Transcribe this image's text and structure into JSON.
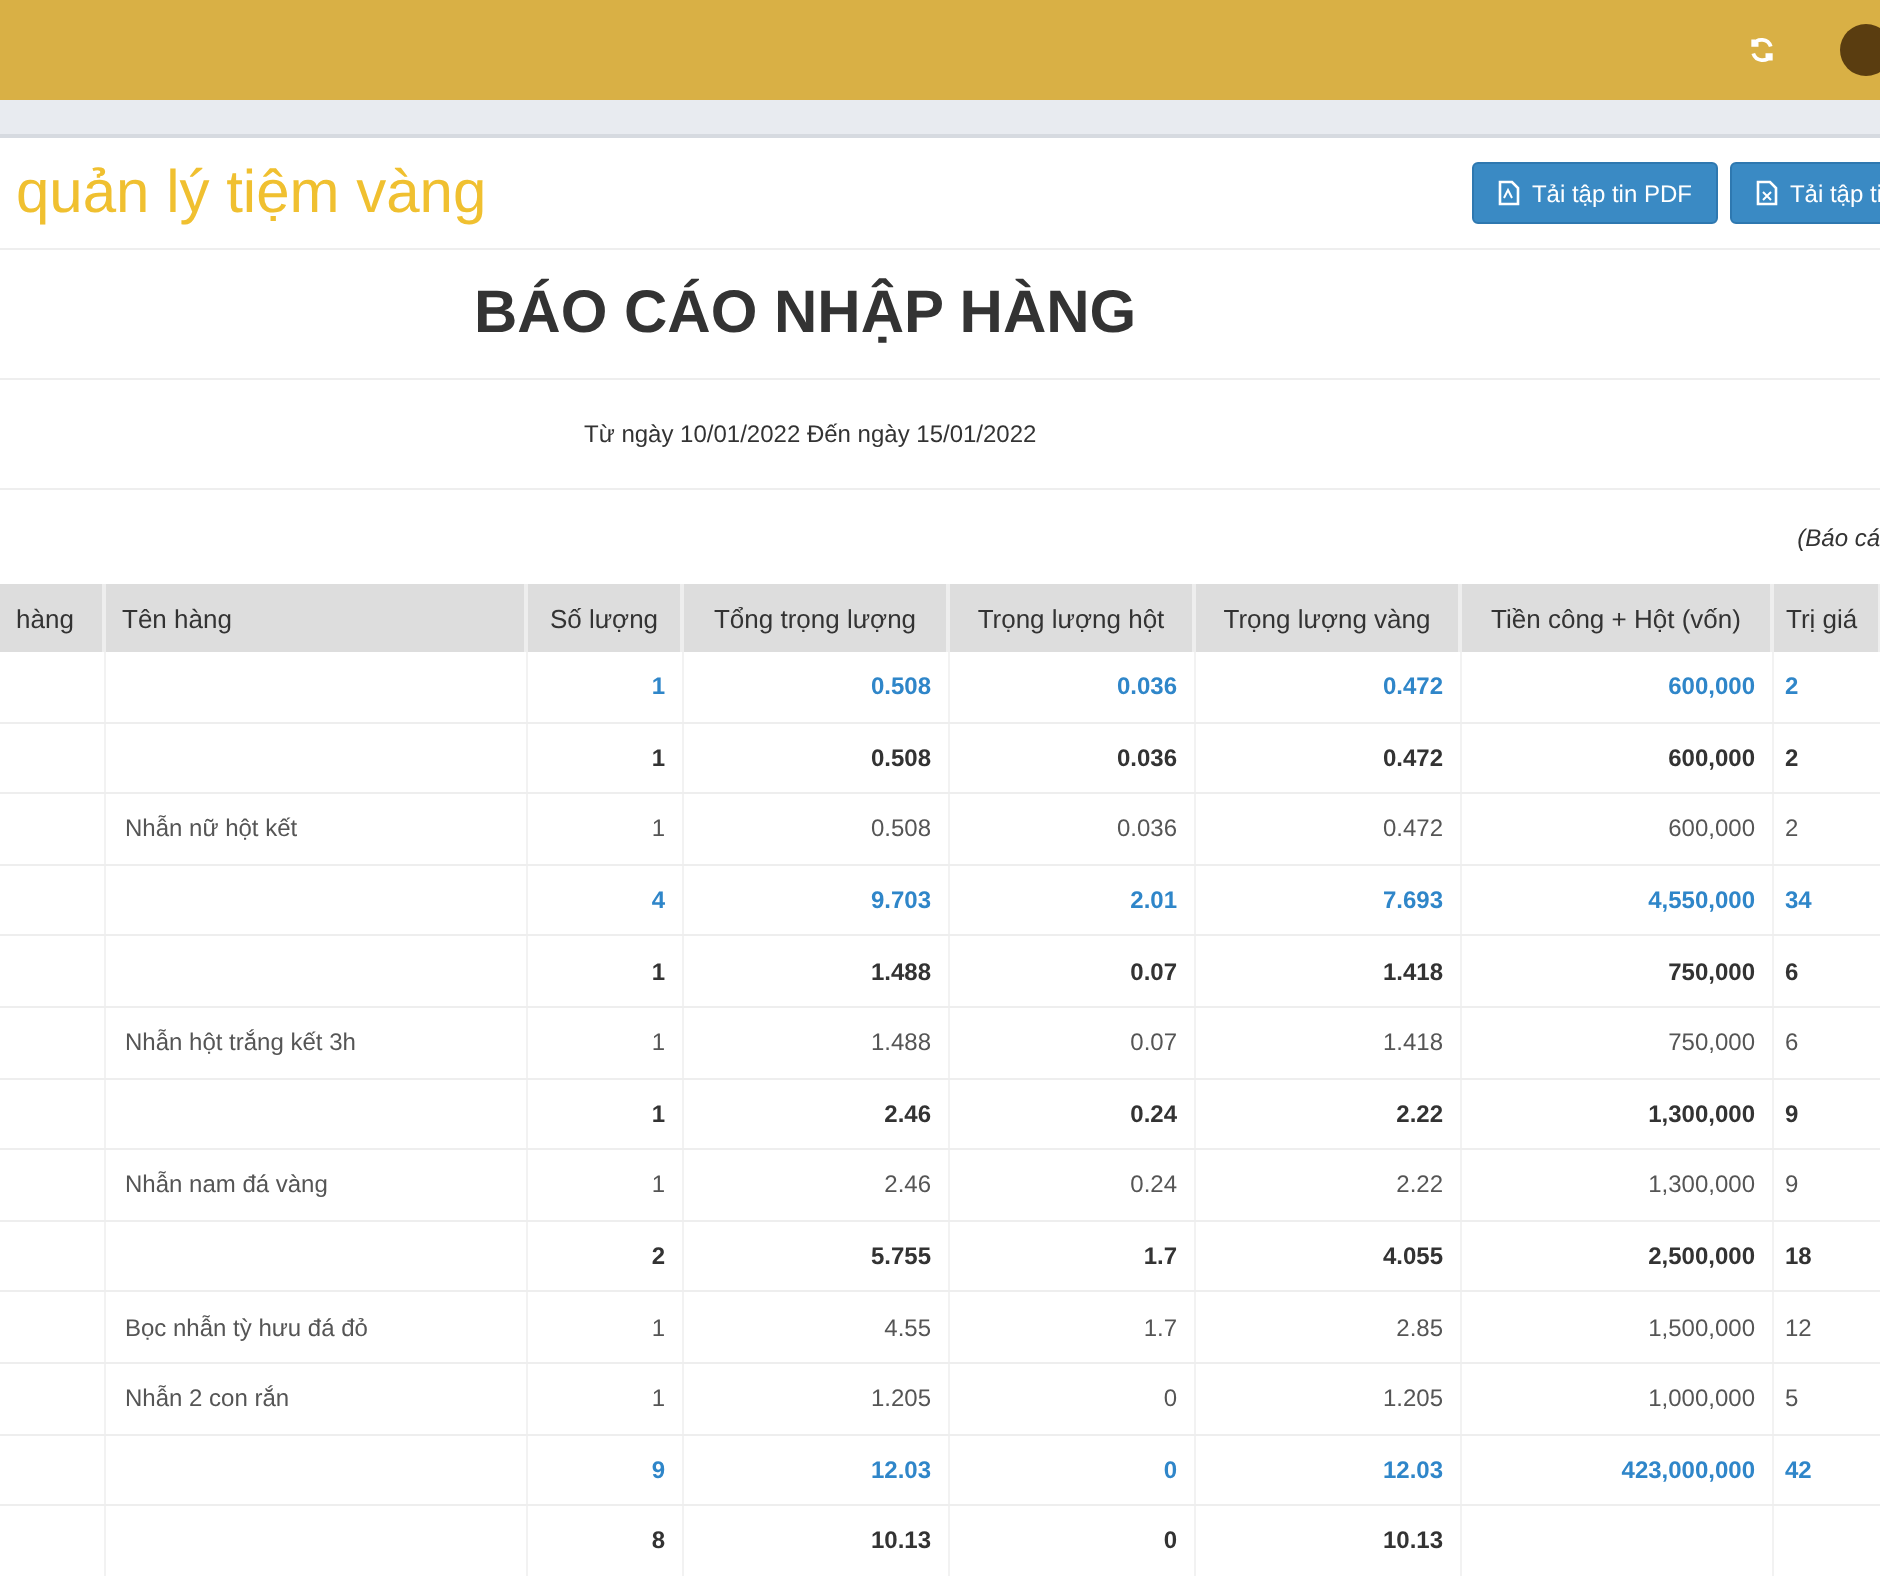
{
  "app_title": "quản lý tiệm vàng",
  "buttons": [
    {
      "label": "Tải tập tin PDF",
      "kind": "pdf"
    },
    {
      "label": "Tải tập ti",
      "kind": "excel"
    }
  ],
  "report": {
    "title": "BÁO CÁO NHẬP HÀNG",
    "date_range": "Từ ngày 10/01/2022 Đến ngày 15/01/2022",
    "note": "(Báo cá"
  },
  "table": {
    "columns": [
      "hàng",
      "Tên hàng",
      "Số lượng",
      "Tổng trọng lượng",
      "Trọng lượng hột",
      "Trọng lượng vàng",
      "Tiền công + Hột (vốn)",
      "Trị giá"
    ],
    "rows": [
      {
        "kind": "total",
        "cells": [
          "",
          "",
          "1",
          "0.508",
          "0.036",
          "0.472",
          "600,000",
          "2"
        ]
      },
      {
        "kind": "group",
        "cells": [
          "",
          "",
          "1",
          "0.508",
          "0.036",
          "0.472",
          "600,000",
          "2"
        ]
      },
      {
        "kind": "item",
        "cells": [
          "",
          "Nhẫn nữ hột kết",
          "1",
          "0.508",
          "0.036",
          "0.472",
          "600,000",
          "2"
        ]
      },
      {
        "kind": "total",
        "cells": [
          "",
          "",
          "4",
          "9.703",
          "2.01",
          "7.693",
          "4,550,000",
          "34"
        ]
      },
      {
        "kind": "group",
        "cells": [
          "",
          "",
          "1",
          "1.488",
          "0.07",
          "1.418",
          "750,000",
          "6"
        ]
      },
      {
        "kind": "item",
        "cells": [
          "",
          "Nhẫn hột trắng kết 3h",
          "1",
          "1.488",
          "0.07",
          "1.418",
          "750,000",
          "6"
        ]
      },
      {
        "kind": "group",
        "cells": [
          "",
          "",
          "1",
          "2.46",
          "0.24",
          "2.22",
          "1,300,000",
          "9"
        ]
      },
      {
        "kind": "item",
        "cells": [
          "",
          "Nhẫn nam đá vàng",
          "1",
          "2.46",
          "0.24",
          "2.22",
          "1,300,000",
          "9"
        ]
      },
      {
        "kind": "group",
        "cells": [
          "",
          "",
          "2",
          "5.755",
          "1.7",
          "4.055",
          "2,500,000",
          "18"
        ]
      },
      {
        "kind": "item",
        "cells": [
          "",
          "Bọc nhẫn tỳ hưu đá đỏ",
          "1",
          "4.55",
          "1.7",
          "2.85",
          "1,500,000",
          "12"
        ]
      },
      {
        "kind": "item",
        "cells": [
          "",
          "Nhẫn 2 con rắn",
          "1",
          "1.205",
          "0",
          "1.205",
          "1,000,000",
          "5"
        ]
      },
      {
        "kind": "total",
        "cells": [
          "",
          "",
          "9",
          "12.03",
          "0",
          "12.03",
          "423,000,000",
          "42"
        ]
      },
      {
        "kind": "group",
        "cells": [
          "",
          "",
          "8",
          "10.13",
          "0",
          "10.13",
          "",
          ""
        ]
      }
    ]
  }
}
